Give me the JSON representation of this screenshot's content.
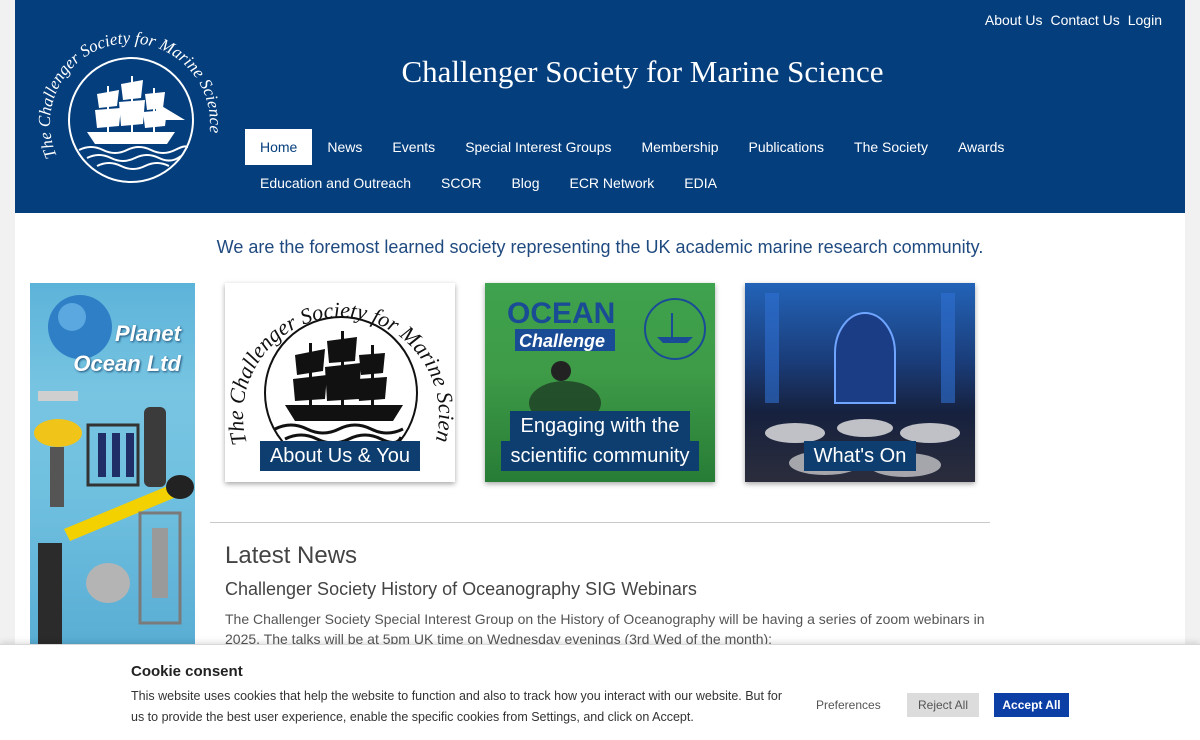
{
  "header": {
    "site_title": "Challenger Society for Marine Science",
    "logo_text": "The Challenger Society for Marine Science",
    "top_links": [
      "About Us",
      "Contact Us",
      "Login"
    ],
    "nav_row1": [
      "Home",
      "News",
      "Events",
      "Special Interest Groups",
      "Membership",
      "Publications",
      "The Society",
      "Awards"
    ],
    "nav_row2": [
      "Education and Outreach",
      "SCOR",
      "Blog",
      "ECR Network",
      "EDIA"
    ],
    "active_nav": "Home"
  },
  "tagline": "We are the foremost learned society representing the UK academic marine research community.",
  "ad": {
    "line1": "Planet",
    "line2": "Ocean Ltd"
  },
  "cards": [
    {
      "label": "About Us & You",
      "image_text": "The Challenger Society for Marine Science"
    },
    {
      "label_line1": "Engaging with the",
      "label_line2": "scientific community",
      "image_title": "OCEAN",
      "image_subtitle": "Challenge"
    },
    {
      "label": "What's On"
    }
  ],
  "news": {
    "heading": "Latest News",
    "title": "Challenger Society History of Oceanography SIG Webinars",
    "body": "The Challenger Society Special Interest Group on the History of Oceanography will be having a series of zoom webinars in 2025. The talks will be at 5pm UK time on Wednesday evenings (3rd Wed of the month):"
  },
  "cookie": {
    "title": "Cookie consent",
    "text": "This website uses cookies that help the website to function and also to track how you interact with our website. But for us to provide the best user experience, enable the specific cookies from Settings, and click on Accept.",
    "preferences": "Preferences",
    "reject": "Reject All",
    "accept": "Accept All"
  },
  "colors": {
    "header_bg": "#043e7d",
    "accent_button": "#0b3fa6",
    "tagline": "#1f4a80"
  }
}
